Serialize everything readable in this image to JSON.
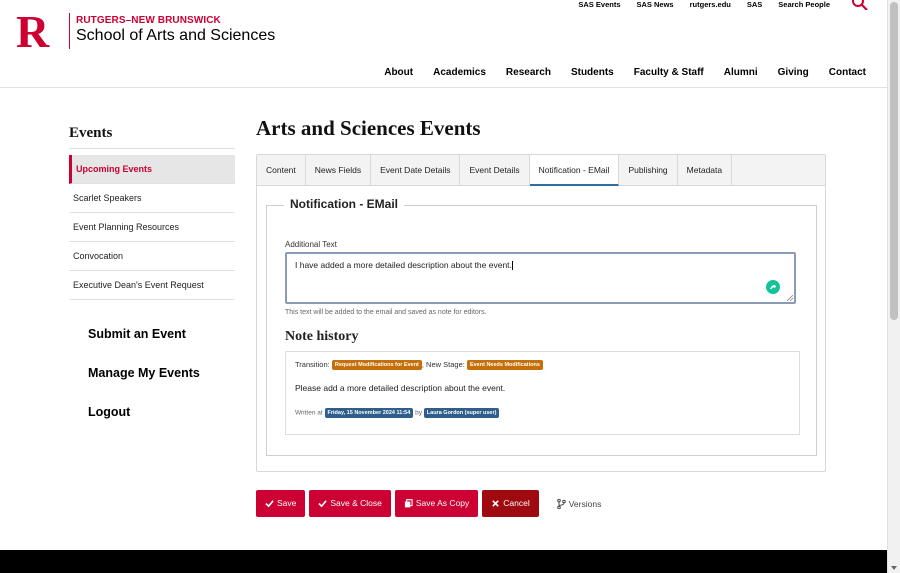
{
  "brand": {
    "logo_letter": "R",
    "top_line": "RUTGERS–NEW BRUNSWICK",
    "main_line": "School of Arts and Sciences",
    "colors": {
      "scarlet": "#cc0033",
      "dark_red": "#9e0a0f",
      "tab_active_underline": "#2d6fa3"
    }
  },
  "utility_nav": [
    "SAS Events",
    "SAS News",
    "rutgers.edu",
    "SAS",
    "Search People"
  ],
  "main_nav": [
    "About",
    "Academics",
    "Research",
    "Students",
    "Faculty & Staff",
    "Alumni",
    "Giving",
    "Contact"
  ],
  "sidebar": {
    "title": "Events",
    "items": [
      {
        "label": "Upcoming Events",
        "active": true
      },
      {
        "label": "Scarlet Speakers"
      },
      {
        "label": "Event Planning Resources"
      },
      {
        "label": "Convocation"
      },
      {
        "label": "Executive Dean's Event Request"
      }
    ],
    "links": [
      "Submit an Event",
      "Manage My Events",
      "Logout"
    ]
  },
  "main": {
    "title": "Arts and Sciences Events",
    "tabs": [
      "Content",
      "News Fields",
      "Event Date Details",
      "Event Details",
      "Notification - EMail",
      "Publishing",
      "Metadata"
    ],
    "active_tab": "Notification - EMail",
    "fieldset": {
      "legend": "Notification - EMail",
      "label": "Additional Text",
      "value": "I have added a more detailed description about the event.",
      "help": "This text will be added to the email and saved as note for editors."
    },
    "note_history": {
      "title": "Note history",
      "transition_label": "Transition:",
      "transition_value": "Request Modifications for Event",
      "stage_label": ", New Stage:",
      "stage_value": "Event Needs Modifications",
      "message": "Please add a more detailed description about the event.",
      "written_label": "Written at",
      "written_value": "Friday, 15 November 2024 11:54",
      "by_label": "by",
      "by_value": "Laura Gordon (super user)"
    }
  },
  "actions": {
    "save": "Save",
    "save_close": "Save & Close",
    "save_copy": "Save As Copy",
    "cancel": "Cancel",
    "versions": "Versions"
  }
}
